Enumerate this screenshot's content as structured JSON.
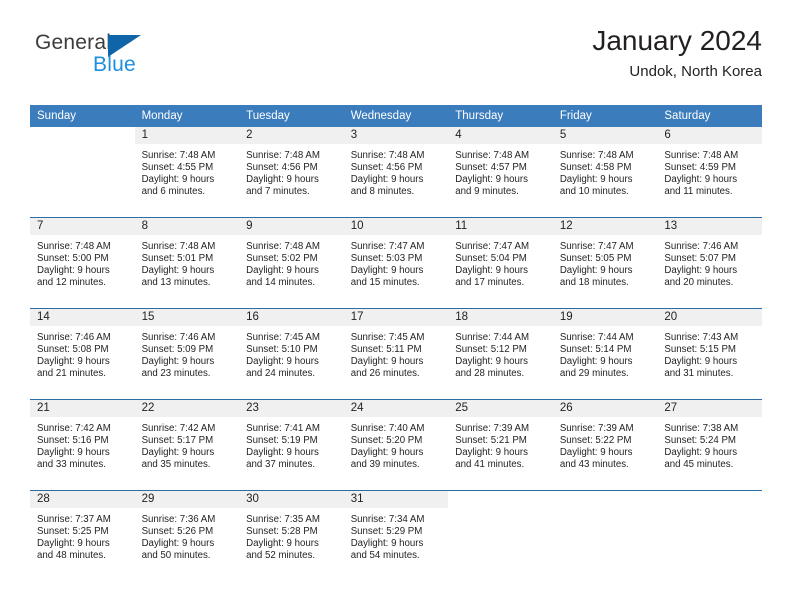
{
  "brand": {
    "name_part1": "General",
    "name_part2": "Blue",
    "triangle_color": "#1064a8",
    "blue_color": "#1d8fe0"
  },
  "header": {
    "title": "January 2024",
    "subtitle": "Undok, North Korea"
  },
  "theme": {
    "header_bg": "#3b7cbd",
    "row_divider": "#2e6da4",
    "daynum_band_bg": "#f0f0f0",
    "text": "#231f20"
  },
  "weekday_headers": [
    "Sunday",
    "Monday",
    "Tuesday",
    "Wednesday",
    "Thursday",
    "Friday",
    "Saturday"
  ],
  "weeks": [
    [
      {
        "day": "",
        "lines": []
      },
      {
        "day": "1",
        "lines": [
          "Sunrise: 7:48 AM",
          "Sunset: 4:55 PM",
          "Daylight: 9 hours",
          "and 6 minutes."
        ]
      },
      {
        "day": "2",
        "lines": [
          "Sunrise: 7:48 AM",
          "Sunset: 4:56 PM",
          "Daylight: 9 hours",
          "and 7 minutes."
        ]
      },
      {
        "day": "3",
        "lines": [
          "Sunrise: 7:48 AM",
          "Sunset: 4:56 PM",
          "Daylight: 9 hours",
          "and 8 minutes."
        ]
      },
      {
        "day": "4",
        "lines": [
          "Sunrise: 7:48 AM",
          "Sunset: 4:57 PM",
          "Daylight: 9 hours",
          "and 9 minutes."
        ]
      },
      {
        "day": "5",
        "lines": [
          "Sunrise: 7:48 AM",
          "Sunset: 4:58 PM",
          "Daylight: 9 hours",
          "and 10 minutes."
        ]
      },
      {
        "day": "6",
        "lines": [
          "Sunrise: 7:48 AM",
          "Sunset: 4:59 PM",
          "Daylight: 9 hours",
          "and 11 minutes."
        ]
      }
    ],
    [
      {
        "day": "7",
        "lines": [
          "Sunrise: 7:48 AM",
          "Sunset: 5:00 PM",
          "Daylight: 9 hours",
          "and 12 minutes."
        ]
      },
      {
        "day": "8",
        "lines": [
          "Sunrise: 7:48 AM",
          "Sunset: 5:01 PM",
          "Daylight: 9 hours",
          "and 13 minutes."
        ]
      },
      {
        "day": "9",
        "lines": [
          "Sunrise: 7:48 AM",
          "Sunset: 5:02 PM",
          "Daylight: 9 hours",
          "and 14 minutes."
        ]
      },
      {
        "day": "10",
        "lines": [
          "Sunrise: 7:47 AM",
          "Sunset: 5:03 PM",
          "Daylight: 9 hours",
          "and 15 minutes."
        ]
      },
      {
        "day": "11",
        "lines": [
          "Sunrise: 7:47 AM",
          "Sunset: 5:04 PM",
          "Daylight: 9 hours",
          "and 17 minutes."
        ]
      },
      {
        "day": "12",
        "lines": [
          "Sunrise: 7:47 AM",
          "Sunset: 5:05 PM",
          "Daylight: 9 hours",
          "and 18 minutes."
        ]
      },
      {
        "day": "13",
        "lines": [
          "Sunrise: 7:46 AM",
          "Sunset: 5:07 PM",
          "Daylight: 9 hours",
          "and 20 minutes."
        ]
      }
    ],
    [
      {
        "day": "14",
        "lines": [
          "Sunrise: 7:46 AM",
          "Sunset: 5:08 PM",
          "Daylight: 9 hours",
          "and 21 minutes."
        ]
      },
      {
        "day": "15",
        "lines": [
          "Sunrise: 7:46 AM",
          "Sunset: 5:09 PM",
          "Daylight: 9 hours",
          "and 23 minutes."
        ]
      },
      {
        "day": "16",
        "lines": [
          "Sunrise: 7:45 AM",
          "Sunset: 5:10 PM",
          "Daylight: 9 hours",
          "and 24 minutes."
        ]
      },
      {
        "day": "17",
        "lines": [
          "Sunrise: 7:45 AM",
          "Sunset: 5:11 PM",
          "Daylight: 9 hours",
          "and 26 minutes."
        ]
      },
      {
        "day": "18",
        "lines": [
          "Sunrise: 7:44 AM",
          "Sunset: 5:12 PM",
          "Daylight: 9 hours",
          "and 28 minutes."
        ]
      },
      {
        "day": "19",
        "lines": [
          "Sunrise: 7:44 AM",
          "Sunset: 5:14 PM",
          "Daylight: 9 hours",
          "and 29 minutes."
        ]
      },
      {
        "day": "20",
        "lines": [
          "Sunrise: 7:43 AM",
          "Sunset: 5:15 PM",
          "Daylight: 9 hours",
          "and 31 minutes."
        ]
      }
    ],
    [
      {
        "day": "21",
        "lines": [
          "Sunrise: 7:42 AM",
          "Sunset: 5:16 PM",
          "Daylight: 9 hours",
          "and 33 minutes."
        ]
      },
      {
        "day": "22",
        "lines": [
          "Sunrise: 7:42 AM",
          "Sunset: 5:17 PM",
          "Daylight: 9 hours",
          "and 35 minutes."
        ]
      },
      {
        "day": "23",
        "lines": [
          "Sunrise: 7:41 AM",
          "Sunset: 5:19 PM",
          "Daylight: 9 hours",
          "and 37 minutes."
        ]
      },
      {
        "day": "24",
        "lines": [
          "Sunrise: 7:40 AM",
          "Sunset: 5:20 PM",
          "Daylight: 9 hours",
          "and 39 minutes."
        ]
      },
      {
        "day": "25",
        "lines": [
          "Sunrise: 7:39 AM",
          "Sunset: 5:21 PM",
          "Daylight: 9 hours",
          "and 41 minutes."
        ]
      },
      {
        "day": "26",
        "lines": [
          "Sunrise: 7:39 AM",
          "Sunset: 5:22 PM",
          "Daylight: 9 hours",
          "and 43 minutes."
        ]
      },
      {
        "day": "27",
        "lines": [
          "Sunrise: 7:38 AM",
          "Sunset: 5:24 PM",
          "Daylight: 9 hours",
          "and 45 minutes."
        ]
      }
    ],
    [
      {
        "day": "28",
        "lines": [
          "Sunrise: 7:37 AM",
          "Sunset: 5:25 PM",
          "Daylight: 9 hours",
          "and 48 minutes."
        ]
      },
      {
        "day": "29",
        "lines": [
          "Sunrise: 7:36 AM",
          "Sunset: 5:26 PM",
          "Daylight: 9 hours",
          "and 50 minutes."
        ]
      },
      {
        "day": "30",
        "lines": [
          "Sunrise: 7:35 AM",
          "Sunset: 5:28 PM",
          "Daylight: 9 hours",
          "and 52 minutes."
        ]
      },
      {
        "day": "31",
        "lines": [
          "Sunrise: 7:34 AM",
          "Sunset: 5:29 PM",
          "Daylight: 9 hours",
          "and 54 minutes."
        ]
      },
      {
        "day": "",
        "lines": []
      },
      {
        "day": "",
        "lines": []
      },
      {
        "day": "",
        "lines": []
      }
    ]
  ]
}
